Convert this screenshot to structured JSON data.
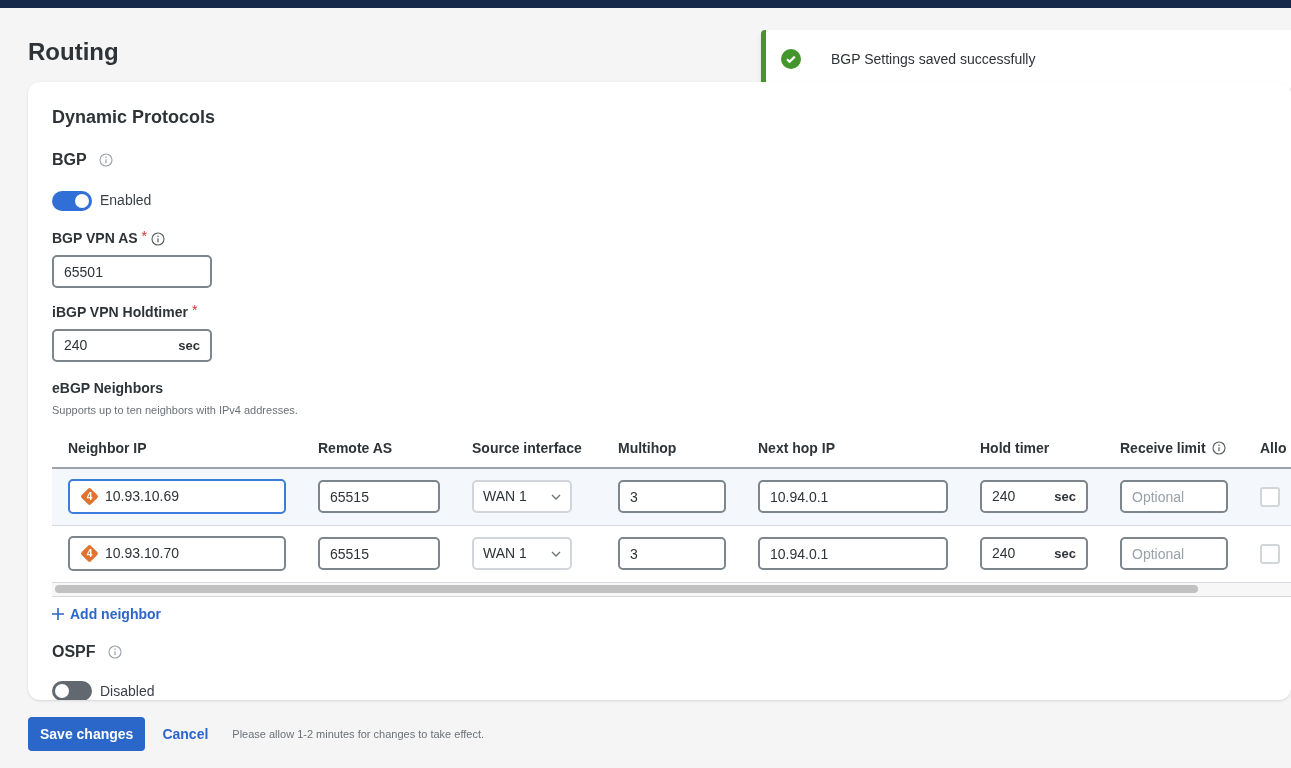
{
  "page_title": "Routing",
  "toast": {
    "kind": "success",
    "message": "BGP Settings saved successfully"
  },
  "card": {
    "title": "Dynamic Protocols",
    "bgp": {
      "title": "BGP",
      "toggle": {
        "on": true,
        "label": "Enabled"
      },
      "vpn_as": {
        "label": "BGP VPN AS",
        "required_mark": "*",
        "value": "65501"
      },
      "holdtimer": {
        "label": "iBGP VPN Holdtimer",
        "required_mark": "*",
        "value": "240",
        "unit": "sec"
      },
      "neighbors": {
        "title": "eBGP Neighbors",
        "description": "Supports up to ten neighbors with IPv4 addresses.",
        "columns": [
          {
            "label": "Neighbor IP"
          },
          {
            "label": "Remote AS"
          },
          {
            "label": "Source interface"
          },
          {
            "label": "Multihop"
          },
          {
            "label": "Next hop IP"
          },
          {
            "label": "Hold timer"
          },
          {
            "label": "Receive limit",
            "info": true
          },
          {
            "label": "Allo"
          }
        ],
        "rows": [
          {
            "selected": true,
            "ip_badge": "4",
            "neighbor_ip": "10.93.10.69",
            "remote_as": "65515",
            "source_interface": "WAN 1",
            "multihop": "3",
            "next_hop_ip": "10.94.0.1",
            "hold_timer": "240",
            "hold_unit": "sec",
            "receive_limit_placeholder": "Optional",
            "allow_checked": false
          },
          {
            "selected": false,
            "ip_badge": "4",
            "neighbor_ip": "10.93.10.70",
            "remote_as": "65515",
            "source_interface": "WAN 1",
            "multihop": "3",
            "next_hop_ip": "10.94.0.1",
            "hold_timer": "240",
            "hold_unit": "sec",
            "receive_limit_placeholder": "Optional",
            "allow_checked": false
          }
        ],
        "add_button": "Add neighbor"
      }
    },
    "ospf": {
      "title": "OSPF",
      "toggle": {
        "on": false,
        "label": "Disabled"
      }
    }
  },
  "actions": {
    "save": "Save changes",
    "cancel": "Cancel",
    "note": "Please allow 1-2 minutes for changes to take effect."
  }
}
